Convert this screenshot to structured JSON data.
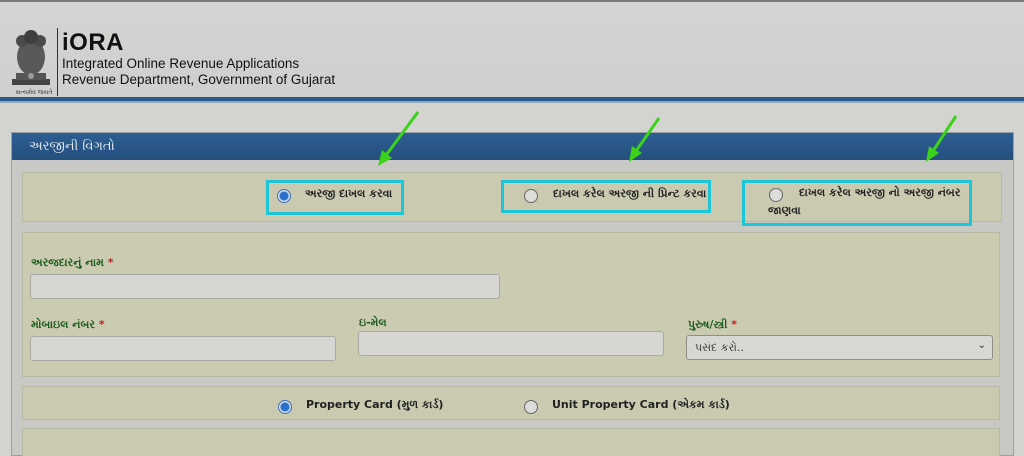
{
  "header": {
    "emblem_caption": "સત્યમેવ જયતે",
    "brand_name": "iORA",
    "brand_line1": "Integrated Online Revenue Applications",
    "brand_line2": "Revenue Department, Government of Gujarat"
  },
  "panel": {
    "title": "અરજીની વિગતો"
  },
  "application_options": [
    {
      "label": "અરજી દાખલ કરવા",
      "selected": true
    },
    {
      "label": "દાખલ કરેલ અરજી ની પ્રિન્ટ કરવા",
      "selected": false
    },
    {
      "label_line1": "દાખલ કરેલ અરજી નો અરજી નંબર",
      "label_line2": "જાણવા",
      "selected": false
    }
  ],
  "form": {
    "applicant_name_label": "અરજદારનું નામ",
    "mobile_label": "મોબાઇલ નંબર",
    "email_label": "ઇ-મેલ",
    "gender_label": "પુરુષ/સ્ત્રી",
    "required_mark": "*",
    "gender_select_value": "પસંદ કરો..",
    "applicant_name_value": "",
    "mobile_value": "",
    "email_value": ""
  },
  "card_options": [
    {
      "label": "Property Card (મુળ કાર્ડ)",
      "selected": true
    },
    {
      "label": "Unit Property Card (એકમ કાર્ડ)",
      "selected": false
    }
  ],
  "colors": {
    "highlight": "#1cc6d6",
    "arrow": "#3cd21c",
    "header_blue": "#2b5a8d",
    "label_green": "#1f5c1f"
  }
}
